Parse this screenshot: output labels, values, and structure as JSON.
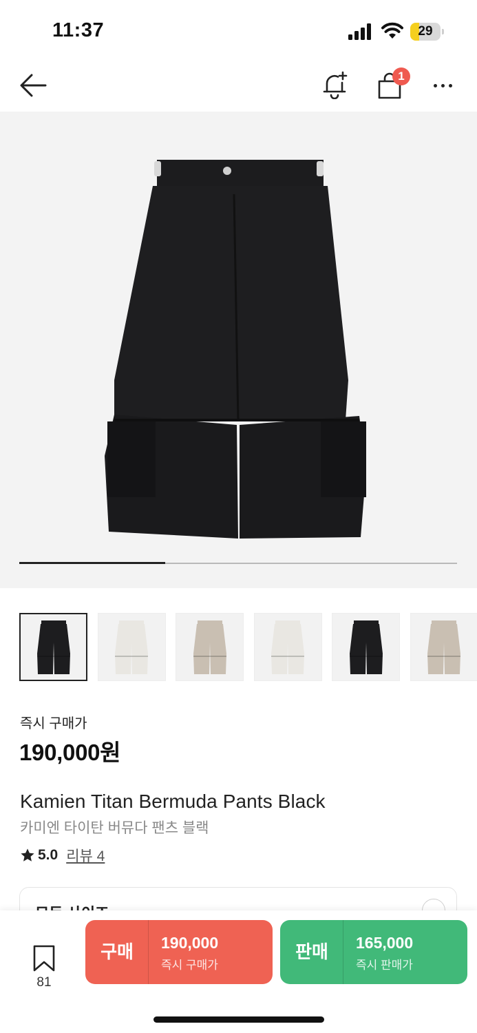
{
  "status_bar": {
    "time": "11:37",
    "battery_level": "29",
    "battery_fraction": 0.29,
    "battery_color": "#f5cf1f"
  },
  "nav": {
    "back_icon": "arrow-left-icon",
    "alert_icon": "bell-plus-icon",
    "cart_icon": "shopping-bag-icon",
    "cart_badge": "1",
    "more_icon": "more-horizontal-icon"
  },
  "gallery": {
    "progress_fraction": 0.333,
    "thumbnails": [
      {
        "color": "black",
        "selected": true
      },
      {
        "color": "white",
        "selected": false
      },
      {
        "color": "beige",
        "selected": false
      },
      {
        "color": "white",
        "selected": false
      },
      {
        "color": "black",
        "selected": false
      },
      {
        "color": "beige",
        "selected": false
      }
    ]
  },
  "price": {
    "label": "즉시 구매가",
    "value": "190,000원"
  },
  "product": {
    "name": "Kamien Titan Bermuda Pants Black",
    "name_ko": "카미엔 타이탄 버뮤다 팬츠 블랙",
    "rating_icon": "star-icon",
    "rating": "5.0",
    "review_link": "리뷰 4"
  },
  "size_select": {
    "label": "모든 사이즈",
    "icon": "chevron-down-icon"
  },
  "bottom_bar": {
    "wish_icon": "bookmark-icon",
    "wish_count": "81",
    "buy": {
      "kind": "구매",
      "price": "190,000",
      "sub": "즉시 구매가",
      "color": "#ef6253"
    },
    "sell": {
      "kind": "판매",
      "price": "165,000",
      "sub": "즉시 판매가",
      "color": "#41b979"
    }
  }
}
